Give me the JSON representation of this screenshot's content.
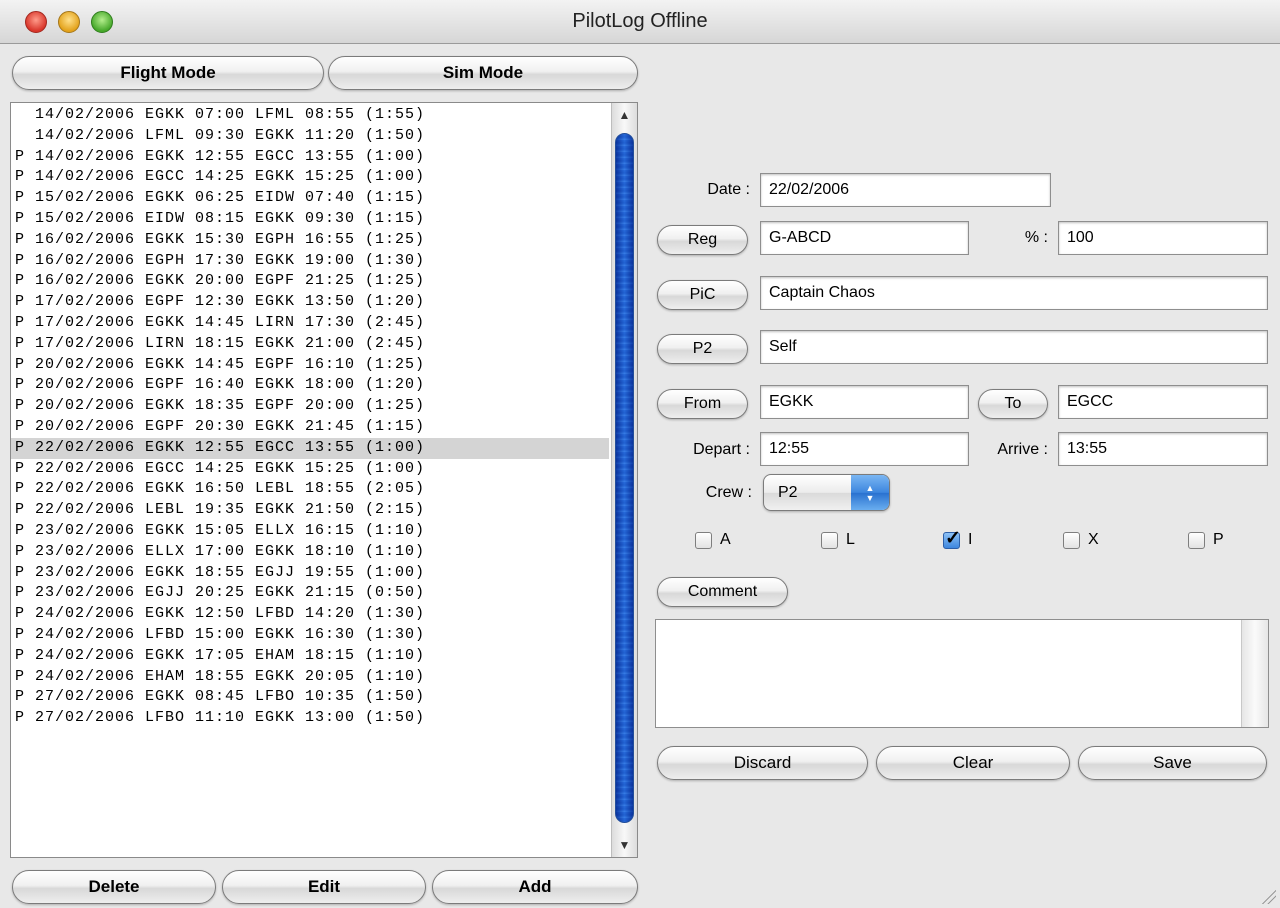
{
  "window": {
    "title": "PilotLog Offline"
  },
  "mode_buttons": {
    "flight": "Flight Mode",
    "sim": "Sim Mode"
  },
  "list": {
    "rows": [
      "  14/02/2006 EGKK 07:00 LFML 08:55 (1:55)",
      "  14/02/2006 LFML 09:30 EGKK 11:20 (1:50)",
      "P 14/02/2006 EGKK 12:55 EGCC 13:55 (1:00)",
      "P 14/02/2006 EGCC 14:25 EGKK 15:25 (1:00)",
      "P 15/02/2006 EGKK 06:25 EIDW 07:40 (1:15)",
      "P 15/02/2006 EIDW 08:15 EGKK 09:30 (1:15)",
      "P 16/02/2006 EGKK 15:30 EGPH 16:55 (1:25)",
      "P 16/02/2006 EGPH 17:30 EGKK 19:00 (1:30)",
      "P 16/02/2006 EGKK 20:00 EGPF 21:25 (1:25)",
      "P 17/02/2006 EGPF 12:30 EGKK 13:50 (1:20)",
      "P 17/02/2006 EGKK 14:45 LIRN 17:30 (2:45)",
      "P 17/02/2006 LIRN 18:15 EGKK 21:00 (2:45)",
      "P 20/02/2006 EGKK 14:45 EGPF 16:10 (1:25)",
      "P 20/02/2006 EGPF 16:40 EGKK 18:00 (1:20)",
      "P 20/02/2006 EGKK 18:35 EGPF 20:00 (1:25)",
      "P 20/02/2006 EGPF 20:30 EGKK 21:45 (1:15)",
      "P 22/02/2006 EGKK 12:55 EGCC 13:55 (1:00)",
      "P 22/02/2006 EGCC 14:25 EGKK 15:25 (1:00)",
      "P 22/02/2006 EGKK 16:50 LEBL 18:55 (2:05)",
      "P 22/02/2006 LEBL 19:35 EGKK 21:50 (2:15)",
      "P 23/02/2006 EGKK 15:05 ELLX 16:15 (1:10)",
      "P 23/02/2006 ELLX 17:00 EGKK 18:10 (1:10)",
      "P 23/02/2006 EGKK 18:55 EGJJ 19:55 (1:00)",
      "P 23/02/2006 EGJJ 20:25 EGKK 21:15 (0:50)",
      "P 24/02/2006 EGKK 12:50 LFBD 14:20 (1:30)",
      "P 24/02/2006 LFBD 15:00 EGKK 16:30 (1:30)",
      "P 24/02/2006 EGKK 17:05 EHAM 18:15 (1:10)",
      "P 24/02/2006 EHAM 18:55 EGKK 20:05 (1:10)",
      "P 27/02/2006 EGKK 08:45 LFBO 10:35 (1:50)",
      "P 27/02/2006 LFBO 11:10 EGKK 13:00 (1:50)"
    ],
    "selected_index": 16
  },
  "list_buttons": {
    "delete": "Delete",
    "edit": "Edit",
    "add": "Add"
  },
  "form": {
    "date_label": "Date :",
    "date_value": "22/02/2006",
    "reg_button": "Reg",
    "reg_value": "G-ABCD",
    "percent_label": "% :",
    "percent_value": "100",
    "pic_button": "PiC",
    "pic_value": "Captain Chaos",
    "p2_button": "P2",
    "p2_value": "Self",
    "from_button": "From",
    "from_value": "EGKK",
    "to_button": "To",
    "to_value": "EGCC",
    "depart_label": "Depart :",
    "depart_value": "12:55",
    "arrive_label": "Arrive :",
    "arrive_value": "13:55",
    "crew_label": "Crew :",
    "crew_value": "P2",
    "checkboxes": [
      {
        "label": "A",
        "checked": false
      },
      {
        "label": "L",
        "checked": false
      },
      {
        "label": "I",
        "checked": true
      },
      {
        "label": "X",
        "checked": false
      },
      {
        "label": "P",
        "checked": false
      }
    ],
    "comment_button": "Comment",
    "comment_value": ""
  },
  "action_buttons": {
    "discard": "Discard",
    "clear": "Clear",
    "save": "Save"
  },
  "colors": {
    "selection": "#d4d4d4",
    "scroll_thumb": "#3c7fd6",
    "window_bg": "#e8e8e8"
  }
}
